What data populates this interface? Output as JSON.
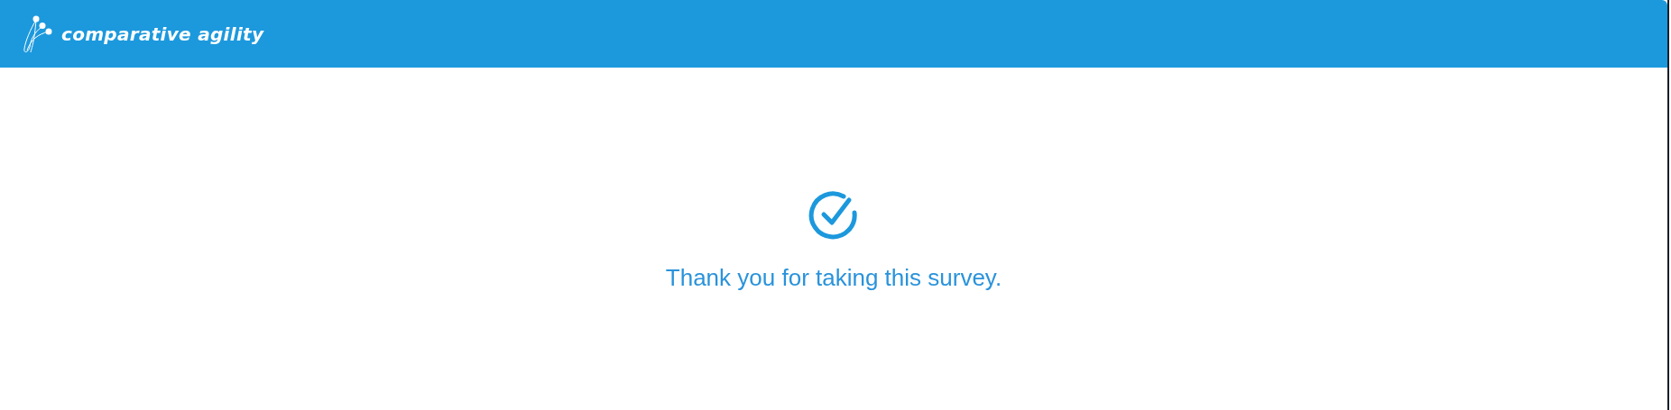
{
  "header": {
    "logo_text": "comparative agility"
  },
  "message": {
    "text": "Thank you for taking this survey."
  }
}
